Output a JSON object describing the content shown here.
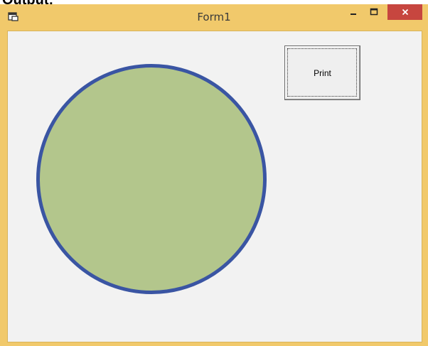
{
  "heading": "Output:",
  "window": {
    "title": "Form1",
    "controls": {
      "minimize_icon": "minimize-icon",
      "maximize_icon": "maximize-icon",
      "close_icon": "close-icon"
    }
  },
  "form": {
    "print_button_label": "Print"
  },
  "colors": {
    "titlebar": "#f1c96b",
    "close_button": "#c7463f",
    "client_background": "#f2f2f2",
    "circle_fill": "#b3c68c",
    "circle_outline": "#3a55a3"
  }
}
